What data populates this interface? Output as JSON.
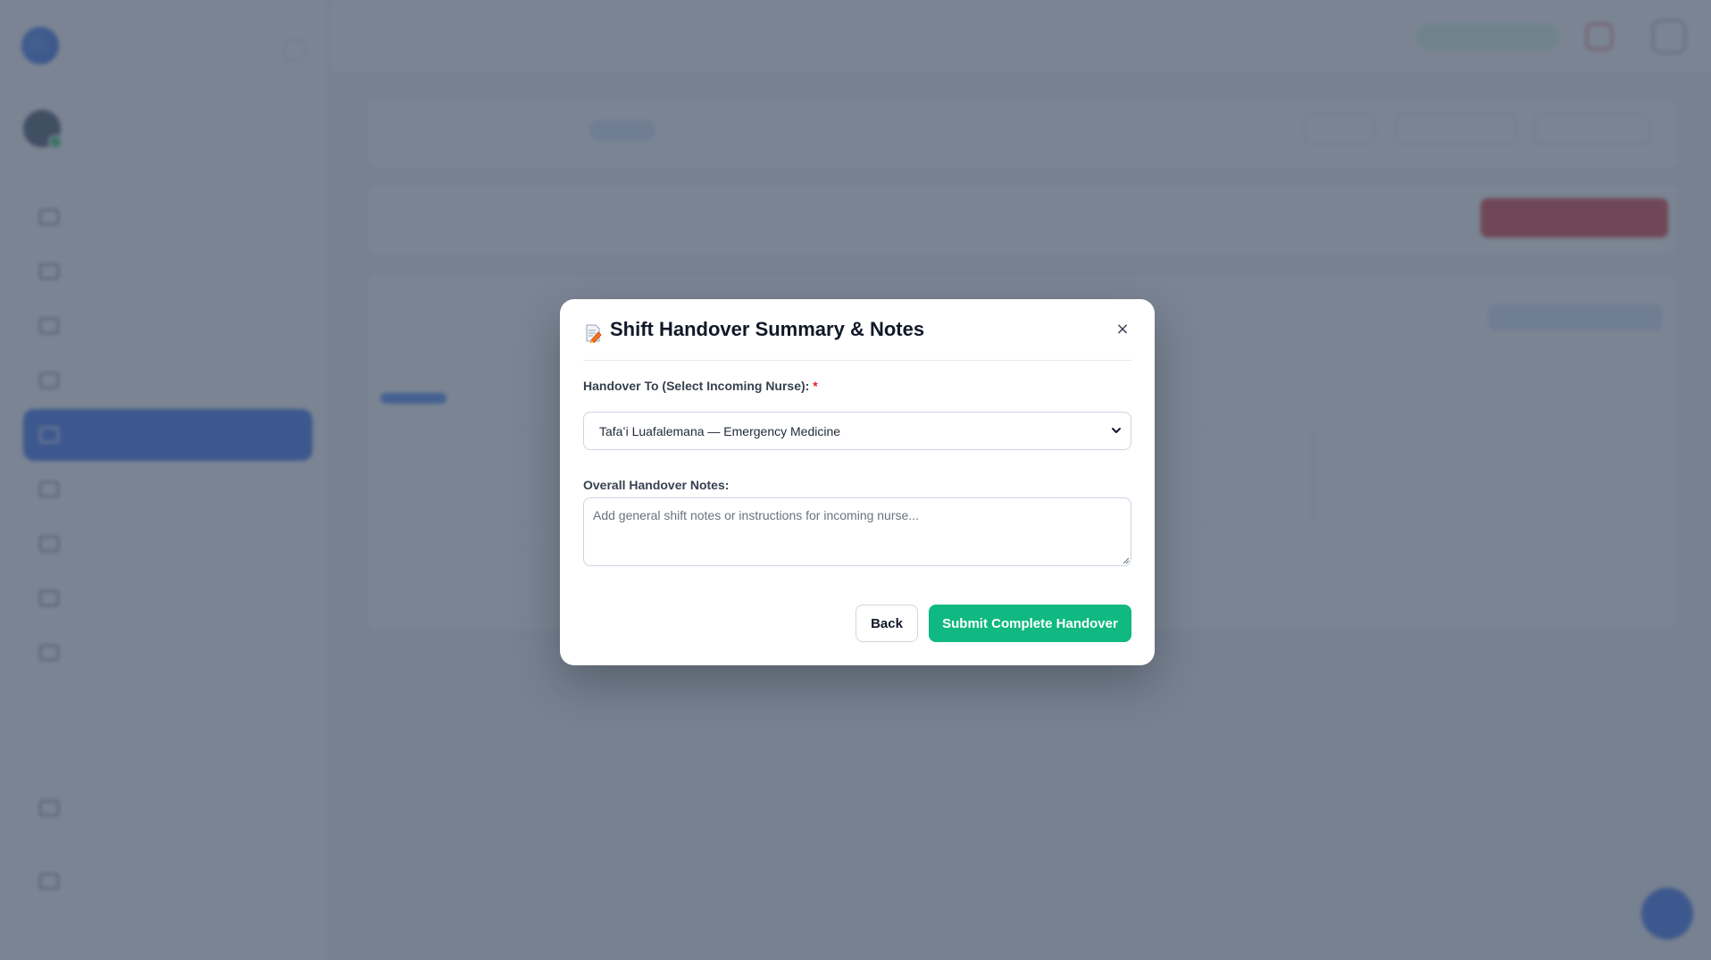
{
  "background": {
    "sidebar_nav_count": 9
  },
  "modal": {
    "title": "Shift Handover Summary & Notes",
    "icon": "memo-icon",
    "close_label": "×",
    "nurse_field": {
      "label": "Handover To (Select Incoming Nurse):",
      "required_marker": "*",
      "selected_value": "Tafaʻi Luafalemana — Emergency Medicine"
    },
    "notes_field": {
      "label": "Overall Handover Notes:",
      "placeholder": "Add general shift notes or instructions for incoming nurse..."
    },
    "back_label": "Back",
    "submit_label": "Submit Complete Handover"
  },
  "colors": {
    "accent": "#2563eb",
    "submit": "#10b981",
    "required": "#dc2626",
    "overlay": "#475569"
  }
}
